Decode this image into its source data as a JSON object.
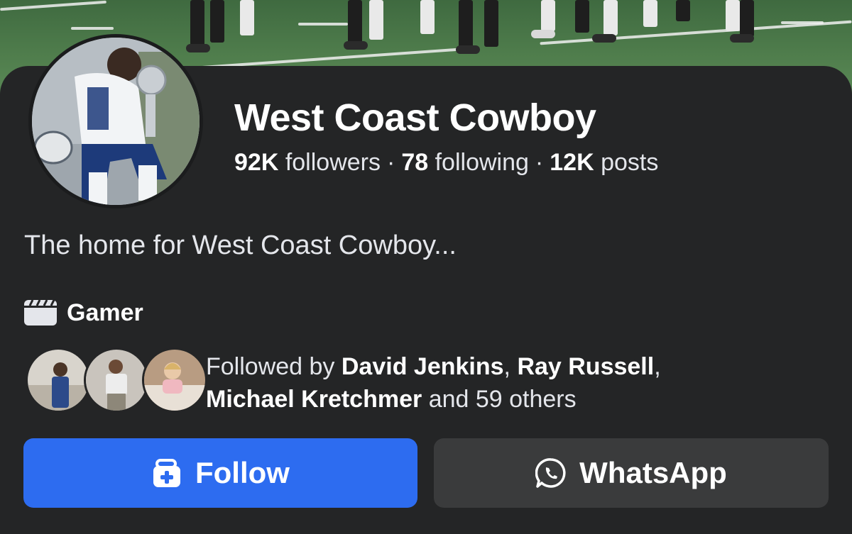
{
  "profile": {
    "name": "West Coast Cowboy",
    "stats": {
      "followers_count": "92K",
      "followers_label": "followers",
      "following_count": "78",
      "following_label": "following",
      "posts_count": "12K",
      "posts_label": "posts",
      "separator": "·"
    },
    "bio": "The home for West Coast Cowboy...",
    "category": "Gamer",
    "category_icon": "clapperboard-icon"
  },
  "followed_by": {
    "prefix": "Followed by",
    "names": [
      "David Jenkins",
      "Ray Russell",
      "Michael Kretchmer"
    ],
    "comma": ",",
    "and_text": "and 59 others"
  },
  "actions": {
    "follow_label": "Follow",
    "follow_icon": "add-friend-icon",
    "whatsapp_label": "WhatsApp",
    "whatsapp_icon": "whatsapp-icon"
  },
  "colors": {
    "background": "#242526",
    "follow_button": "#2d6cf0",
    "secondary_button": "#3a3b3c",
    "text_primary": "#ffffff",
    "text_secondary": "#e4e6eb"
  }
}
